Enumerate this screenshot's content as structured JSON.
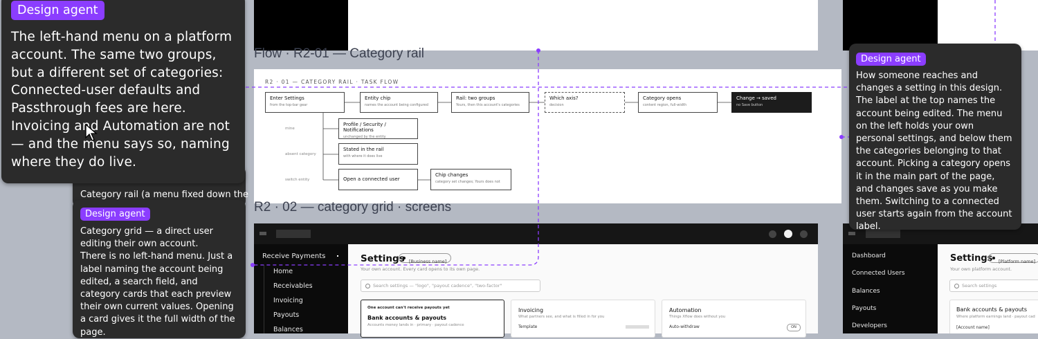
{
  "colors": {
    "accent": "#8b3dff",
    "connector": "#8b3dff",
    "bubble_bg": "#2b2b2b",
    "canvas_bg": "#b4b9c3"
  },
  "flow": {
    "title": "Flow · R2-01 — Category rail",
    "caption": "R2 · 01 — CATEGORY RAIL · TASK FLOW",
    "steps": [
      {
        "title": "Enter Settings",
        "sub": "from the top-bar gear"
      },
      {
        "title": "Entity chip",
        "sub": "names the account being configured"
      },
      {
        "title": "Rail: two groups",
        "sub": "Yours, then this account's categories"
      },
      {
        "title": "Which axis?",
        "sub": "decision"
      },
      {
        "title": "Category opens",
        "sub": "content region, full-width"
      },
      {
        "title": "Change → saved",
        "sub": "no Save button"
      }
    ],
    "branches": [
      {
        "label": "mine",
        "title": "Profile / Security / Notifications",
        "sub": "unchanged by the entity"
      },
      {
        "label": "absent category",
        "title": "Stated in the rail",
        "sub": "with where it does live"
      },
      {
        "label": "switch entity",
        "title": "Open a connected user",
        "sub": ""
      }
    ],
    "chip_changes": {
      "title": "Chip changes",
      "sub": "category set changes; Yours does not"
    }
  },
  "grid": {
    "title": "R2 · 02 — category grid · screens"
  },
  "mock1": {
    "nav": [
      "Receive Payments",
      "Home",
      "Receivables",
      "Invoicing",
      "Payouts",
      "Balances"
    ],
    "settings_title": "Settings",
    "entity_chip": "[Business name]",
    "subtitle": "Your own account. Every card opens to its own page.",
    "search_placeholder": "Search settings — \"logo\", \"payout cadence\", \"two-factor\"",
    "card1": {
      "kicker": "One account can't receive payouts yet",
      "title": "Bank accounts & payouts",
      "sub": "Accounts money lands in · primary · payout cadence"
    },
    "card2": {
      "title": "Invoicing",
      "sub": "What partners see, and what is filled in for you",
      "row": "Template"
    },
    "card3": {
      "title": "Automation",
      "sub": "Things Xflow does without you",
      "row": "Auto-withdraw",
      "toggle": "ON"
    }
  },
  "mock2": {
    "nav": [
      "Dashboard",
      "Connected Users",
      "Balances",
      "Payouts",
      "Developers"
    ],
    "settings_title": "Settings",
    "entity_chip": "[Platform name]",
    "subtitle": "Your own platform account.",
    "search_placeholder": "Search settings",
    "card1": {
      "title": "Bank accounts & payouts",
      "sub": "Where platform earnings land · payout cad",
      "row": "[Account name]"
    }
  },
  "bubble_top": {
    "badge": "Design agent",
    "text": "The left-hand menu on a platform account. The same two groups, but a different set of categories: Connected-user defaults and Passthrough fees are here. Invoicing and Automation are not — and the menu says so, naming where they do live."
  },
  "bubble_mid_peek": {
    "text": "Category rail (a menu fixed down the"
  },
  "bubble_mid": {
    "badge": "Design agent",
    "text": "Category grid — a direct user editing their own account.\nThere is no left-hand menu. Just a label naming the account being edited, a search field, and category cards that each preview their own current values. Opening a card gives it the full width of the page."
  },
  "bubble_right": {
    "badge": "Design agent",
    "text": "How someone reaches and changes a setting in this design.\nThe label at the top names the account being edited. The menu on the left holds your own personal settings, and below them the categories belonging to that account. Picking a category opens it in the main part of the page, and changes save as you make them. Switching to a connected user starts again from the account label."
  }
}
